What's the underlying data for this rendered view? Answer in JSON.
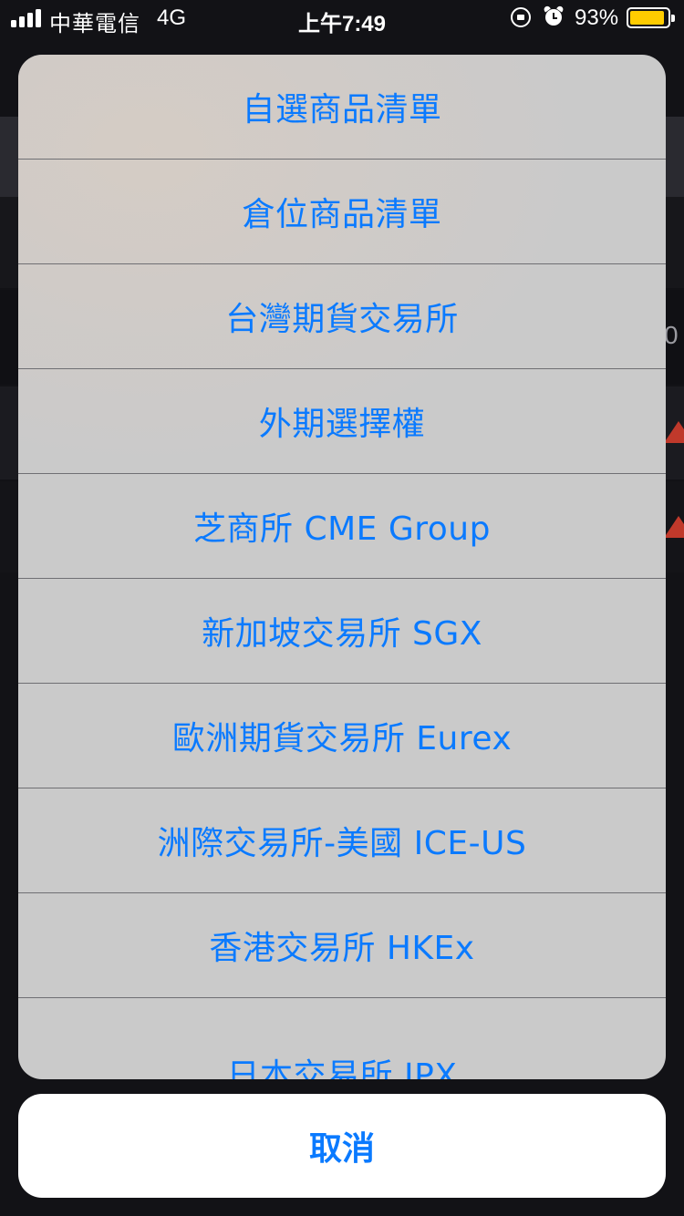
{
  "status_bar": {
    "carrier": "中華電信",
    "network": "4G",
    "time": "上午7:49",
    "battery_percent": "93%",
    "battery_level": 0.93,
    "icons": [
      "signal-icon",
      "orientation-lock-icon",
      "alarm-icon",
      "battery-icon"
    ]
  },
  "background": {
    "edge_text": "0",
    "indicator_color": "#c0392b"
  },
  "action_sheet": {
    "options": [
      {
        "label": "自選商品清單"
      },
      {
        "label": "倉位商品清單"
      },
      {
        "label": "台灣期貨交易所"
      },
      {
        "label": "外期選擇權"
      },
      {
        "label": "芝商所 CME Group"
      },
      {
        "label": "新加坡交易所 SGX"
      },
      {
        "label": "歐洲期貨交易所 Eurex"
      },
      {
        "label": "洲際交易所-美國 ICE-US"
      },
      {
        "label": "香港交易所 HKEx"
      },
      {
        "label": "日本交易所 JPX"
      }
    ],
    "cancel_label": "取消",
    "accent_color": "#0a7aff"
  }
}
